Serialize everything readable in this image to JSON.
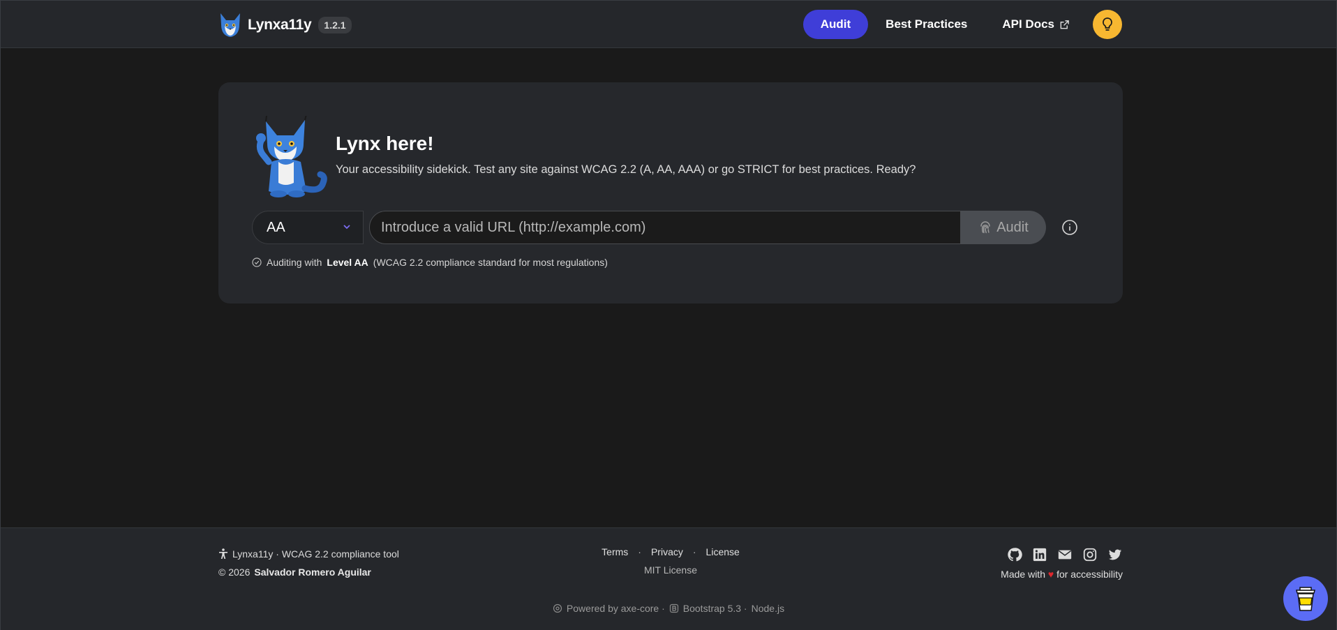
{
  "navbar": {
    "brand_name": "Lynxa11y",
    "version": "1.2.1",
    "links": [
      {
        "label": "Audit"
      },
      {
        "label": "Best Practices"
      },
      {
        "label": "API Docs"
      }
    ]
  },
  "hero": {
    "title": "Lynx here!",
    "subtitle": "Your accessibility sidekick. Test any site against WCAG 2.2 (A, AA, AAA) or go STRICT for best practices. Ready?"
  },
  "audit_form": {
    "level_selected": "AA",
    "url_placeholder": "Introduce a valid URL (http://example.com)",
    "url_value": "",
    "submit_label": "Audit",
    "note_prefix": "Auditing with",
    "note_level": "Level AA",
    "note_suffix": "(WCAG 2.2 compliance standard for most regulations)"
  },
  "footer": {
    "tagline": "Lynxa11y · WCAG 2.2 compliance tool",
    "copyright_prefix": "© 2026",
    "author": "Salvador Romero Aguilar",
    "links": [
      "Terms",
      "Privacy",
      "License"
    ],
    "license_text": "MIT License",
    "made_prefix": "Made with",
    "made_suffix": "for accessibility",
    "powered": [
      "Powered by axe-core ·",
      "Bootstrap 5.3 ·",
      "Node.js"
    ]
  },
  "colors": {
    "accent": "#3f3ed8",
    "theme_button": "#f7b731",
    "heart": "#e0282e",
    "coffee_button": "#5b6cf5"
  }
}
